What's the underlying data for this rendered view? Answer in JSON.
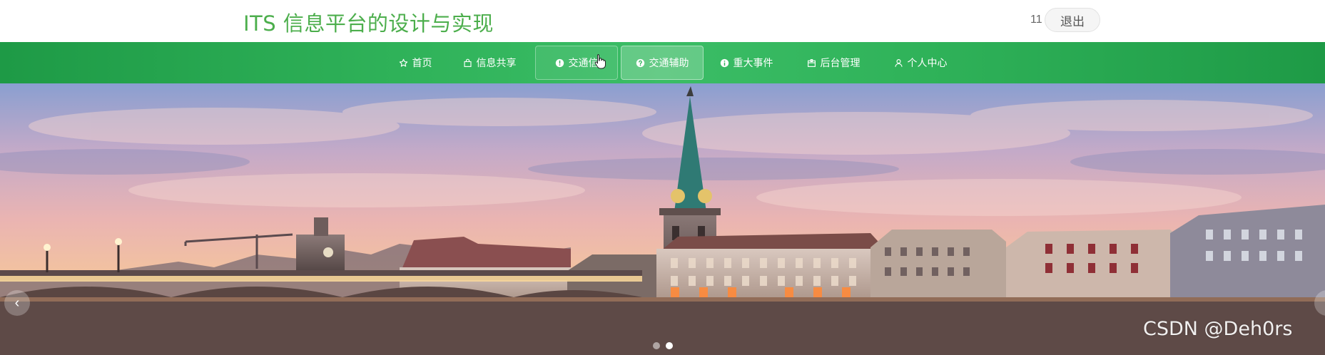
{
  "header": {
    "title": "ITS 信息平台的设计与实现",
    "user_name": "11",
    "logout_label": "退出"
  },
  "nav": {
    "items": [
      {
        "label": "首页",
        "icon": "star-icon"
      },
      {
        "label": "信息共享",
        "icon": "bag-icon"
      },
      {
        "label": "交通信",
        "icon": "info-icon"
      },
      {
        "label": "交通辅助",
        "icon": "help-icon"
      },
      {
        "label": "重大事件",
        "icon": "info-icon"
      },
      {
        "label": "后台管理",
        "icon": "box-icon"
      },
      {
        "label": "个人中心",
        "icon": "user-icon"
      }
    ],
    "active_index": 3,
    "hover_index": 2
  },
  "banner": {
    "prev_label": "‹",
    "watermark": "CSDN @Deh0rs"
  },
  "colors": {
    "title_green": "#4cae4c",
    "nav_green": "#2fb259"
  }
}
